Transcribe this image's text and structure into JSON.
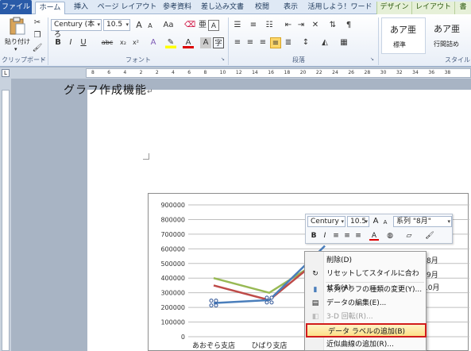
{
  "tabs": {
    "file": "ファイル",
    "home": "ホーム",
    "insert": "挿入",
    "page_layout": "ページ レイアウト",
    "references": "参考資料",
    "mailings": "差し込み文書",
    "review": "校閲",
    "view": "表示",
    "addin": "活用しよう！ワード",
    "design": "デザイン",
    "layout": "レイアウト",
    "format": "書"
  },
  "ribbon": {
    "clipboard_label": "クリップボード",
    "paste_label": "貼り付け",
    "font_label": "フォント",
    "paragraph_label": "段落",
    "style_label": "スタイル",
    "font_name": "Century (本ろ",
    "font_size": "10.5",
    "style_normal_glyph": "あア亜",
    "style_normal_name": "標準",
    "style_nospace_glyph": "あア亜",
    "style_nospace_name": "行間詰め",
    "grow_font": "A",
    "shrink_font": "A",
    "change_case": "Aa",
    "bold": "B",
    "italic": "I",
    "underline": "U",
    "strike": "abc",
    "subscript": "x₂",
    "superscript": "x²",
    "font_color": "A",
    "char_border": "A"
  },
  "ruler": {
    "numbers": [
      "8",
      "6",
      "4",
      "2",
      "2",
      "4",
      "6",
      "8",
      "10",
      "12",
      "14",
      "16",
      "18",
      "20",
      "22",
      "24",
      "26",
      "28",
      "30",
      "32",
      "34",
      "36",
      "38"
    ]
  },
  "document": {
    "title": "グラフ作成機能",
    "paragraph_mark": "↵"
  },
  "chart_data": {
    "type": "line",
    "categories": [
      "あおぞら支店",
      "ひばり支店",
      "ゆ"
    ],
    "y_tick_labels": [
      "900000",
      "800000",
      "700000",
      "600000",
      "500000",
      "400000",
      "300000",
      "200000",
      "100000",
      "0"
    ],
    "ylim": [
      0,
      900000
    ],
    "legend_visible": [
      "8月",
      "9月",
      "10月"
    ],
    "series": [
      {
        "name": "8月",
        "color": "#4a7ebb",
        "values": [
          230000,
          250000,
          620000
        ]
      },
      {
        "name": "9月",
        "color": "#be4b48",
        "values": [
          350000,
          250000,
          560000
        ]
      },
      {
        "name": "10月",
        "color": "#98b954",
        "values": [
          400000,
          300000,
          540000
        ]
      }
    ]
  },
  "minitoolbar": {
    "font_name": "Century",
    "font_size": "10.5",
    "series_select": "系列 \"8月\"",
    "grow": "A",
    "shrink": "A",
    "bold": "B",
    "italic": "I",
    "font_color": "A"
  },
  "context_menu": {
    "items": [
      {
        "label": "削除(D)",
        "disabled": false
      },
      {
        "label": "リセットしてスタイルに合わせる(A)",
        "disabled": false
      },
      {
        "label": "系列グラフの種類の変更(Y)...",
        "disabled": false
      },
      {
        "label": "データの編集(E)...",
        "disabled": false
      },
      {
        "label": "3-D 回転(R)...",
        "disabled": true
      },
      {
        "label": "データ ラベルの追加(B)",
        "disabled": false,
        "selected": true
      },
      {
        "label": "近似曲線の追加(R)...",
        "disabled": false
      }
    ]
  },
  "colors": {
    "file_tab": "#2a5ba8",
    "highlight": "#fde089",
    "selection_outline": "#d11b1b"
  }
}
